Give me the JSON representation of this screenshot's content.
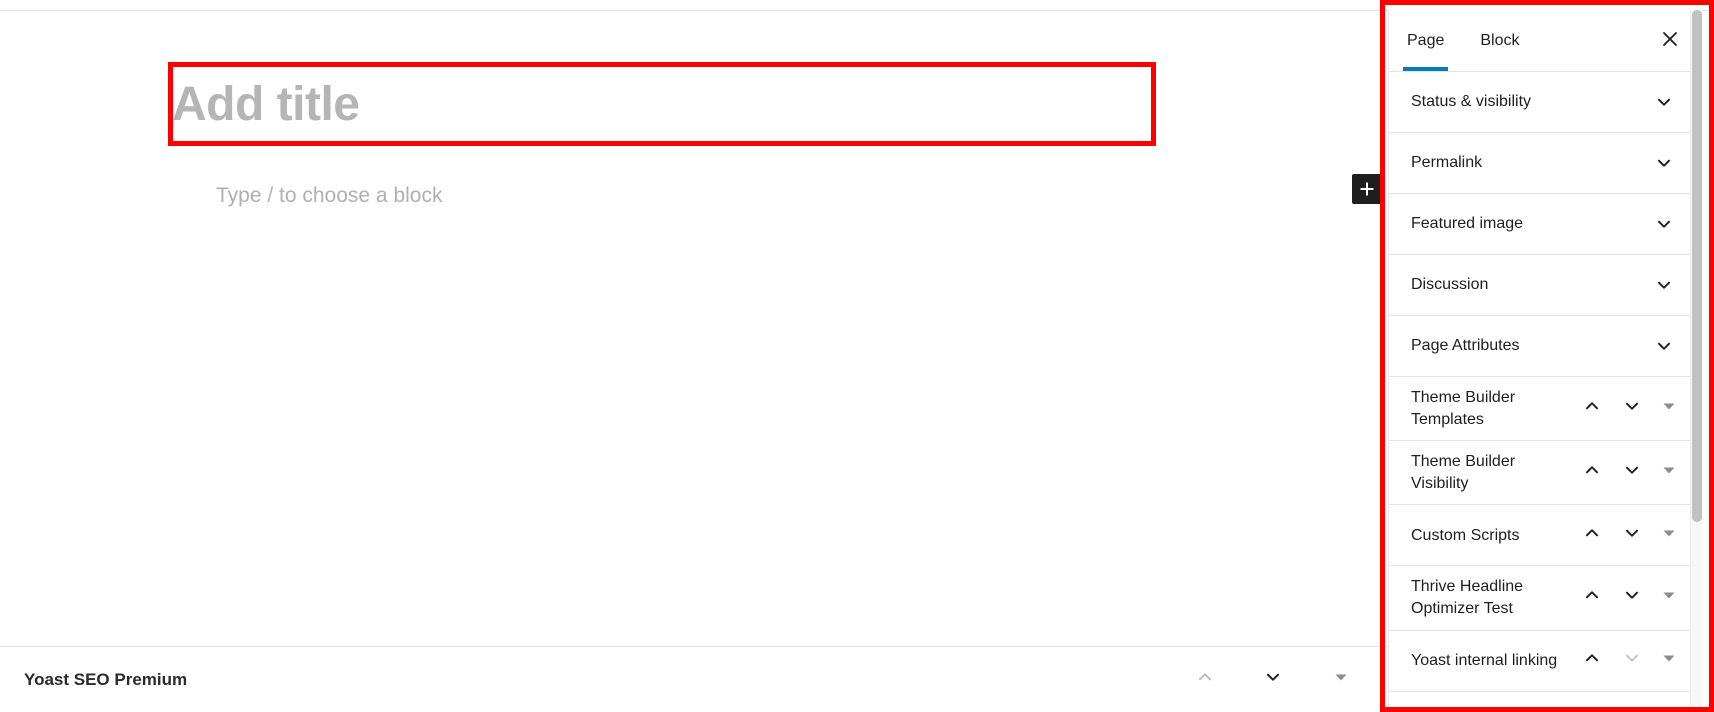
{
  "editor": {
    "title_placeholder": "Add title",
    "block_placeholder": "Type / to choose a block",
    "inserter_label": "+",
    "inserter_icon": "plus-icon"
  },
  "metabox": {
    "title": "Yoast SEO Premium",
    "actions": [
      {
        "icon": "chevron-up-icon",
        "name": "move-up-button",
        "state": "disabled"
      },
      {
        "icon": "chevron-down-icon",
        "name": "move-down-button",
        "state": "enabled"
      },
      {
        "icon": "triangle-down-icon",
        "name": "toggle-panel-button",
        "state": "enabled"
      }
    ]
  },
  "sidebar": {
    "tabs": [
      {
        "label": "Page",
        "active": true
      },
      {
        "label": "Block",
        "active": false
      }
    ],
    "close_label": "×",
    "close_icon": "close-icon",
    "panels": [
      {
        "label": "Status & visibility",
        "type": "core",
        "icon": "chevron-down-icon"
      },
      {
        "label": "Permalink",
        "type": "core",
        "icon": "chevron-down-icon"
      },
      {
        "label": "Featured image",
        "type": "core",
        "icon": "chevron-down-icon"
      },
      {
        "label": "Discussion",
        "type": "core",
        "icon": "chevron-down-icon"
      },
      {
        "label": "Page Attributes",
        "type": "core",
        "icon": "chevron-down-icon"
      },
      {
        "label": "Theme Builder Templates",
        "type": "meta",
        "up": "enabled",
        "down": "enabled",
        "toggle": "enabled"
      },
      {
        "label": "Theme Builder Visibility",
        "type": "meta",
        "up": "enabled",
        "down": "enabled",
        "toggle": "enabled"
      },
      {
        "label": "Custom Scripts",
        "type": "meta",
        "up": "enabled",
        "down": "enabled",
        "toggle": "enabled"
      },
      {
        "label": "Thrive Headline Optimizer Test",
        "type": "meta",
        "up": "enabled",
        "down": "enabled",
        "toggle": "enabled"
      },
      {
        "label": "Yoast internal linking",
        "type": "meta",
        "up": "enabled",
        "down": "disabled",
        "toggle": "enabled"
      }
    ]
  },
  "colors": {
    "accent": "#007cba",
    "annotation": "#ff0000",
    "text": "#1e1e1e",
    "placeholder": "#b5b5b5",
    "border": "#e2e4e7"
  }
}
